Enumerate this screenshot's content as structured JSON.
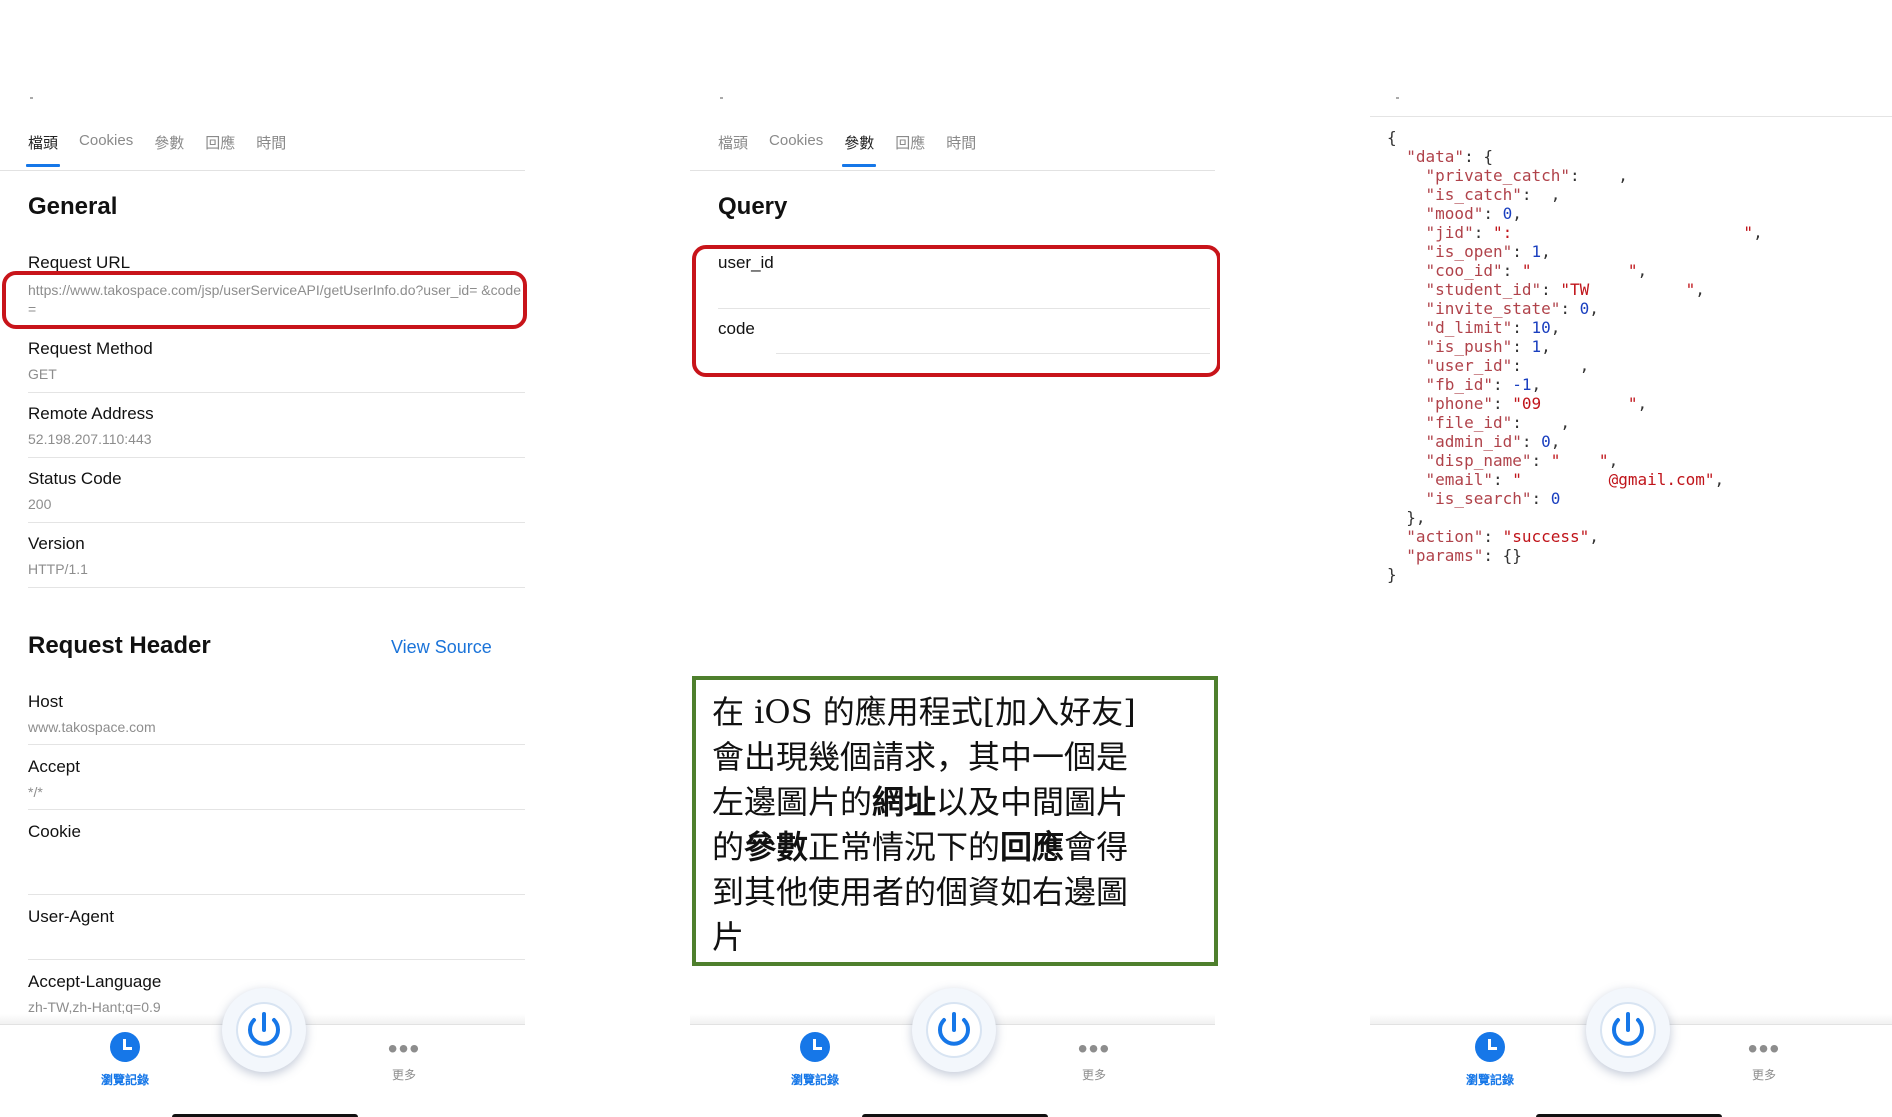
{
  "tabs": [
    "檔頭",
    "Cookies",
    "參數",
    "回應",
    "時間"
  ],
  "left": {
    "section_general": "General",
    "request_url_label": "Request URL",
    "request_url_value": "https://www.takospace.com/jsp/userServiceAPI/getUserInfo.do?user_id=          &code=",
    "request_method_label": "Request Method",
    "request_method_value": "GET",
    "remote_address_label": "Remote Address",
    "remote_address_value": "52.198.207.110:443",
    "status_code_label": "Status Code",
    "status_code_value": "200",
    "version_label": "Version",
    "version_value": "HTTP/1.1",
    "section_request_header": "Request Header",
    "view_source": "View Source",
    "host_label": "Host",
    "host_value": "www.takospace.com",
    "accept_label": "Accept",
    "accept_value": "*/*",
    "cookie_label": "Cookie",
    "user_agent_label": "User-Agent",
    "accept_language_label": "Accept-Language",
    "accept_language_value": "zh-TW,zh-Hant;q=0.9"
  },
  "middle": {
    "section_query": "Query",
    "param1": "user_id",
    "param2": "code"
  },
  "note": {
    "line1": "在 iOS 的應用程式[加入好友]",
    "line2": "會出現幾個請求，其中一個是",
    "line3_a": "左邊圖片的",
    "line3_b": "網址",
    "line3_c": "以及中間圖片",
    "line4_a": "的",
    "line4_b": "參數",
    "line4_c": "正常情況下的",
    "line4_d": "回應",
    "line4_e": "會得",
    "line5": "到其他使用者的個資如右邊圖",
    "line6": "片"
  },
  "json_lines": [
    "{",
    "  \"data\": {",
    "    \"private_catch\":    ,",
    "    \"is_catch\":  ,",
    "    \"mood\": 0,",
    "    \"jid\": \":                        \",",
    "    \"is_open\": 1,",
    "    \"coo_id\": \"          \",",
    "    \"student_id\": \"TW          \",",
    "    \"invite_state\": 0,",
    "    \"d_limit\": 10,",
    "    \"is_push\": 1,",
    "    \"user_id\":      ,",
    "    \"fb_id\": -1,",
    "    \"phone\": \"09         \",",
    "    \"file_id\":    ,",
    "    \"admin_id\": 0,",
    "    \"disp_name\": \"    \",",
    "    \"email\": \"         @gmail.com\",",
    "    \"is_search\": 0",
    "  },",
    "  \"action\": \"success\",",
    "  \"params\": {}",
    "}"
  ],
  "tabbar": {
    "history_label": "瀏覽記錄",
    "more_label": "更多"
  },
  "colors": {
    "accent": "#1677e8",
    "highlight_red": "#c8141a",
    "note_border": "#4e7f2d"
  }
}
